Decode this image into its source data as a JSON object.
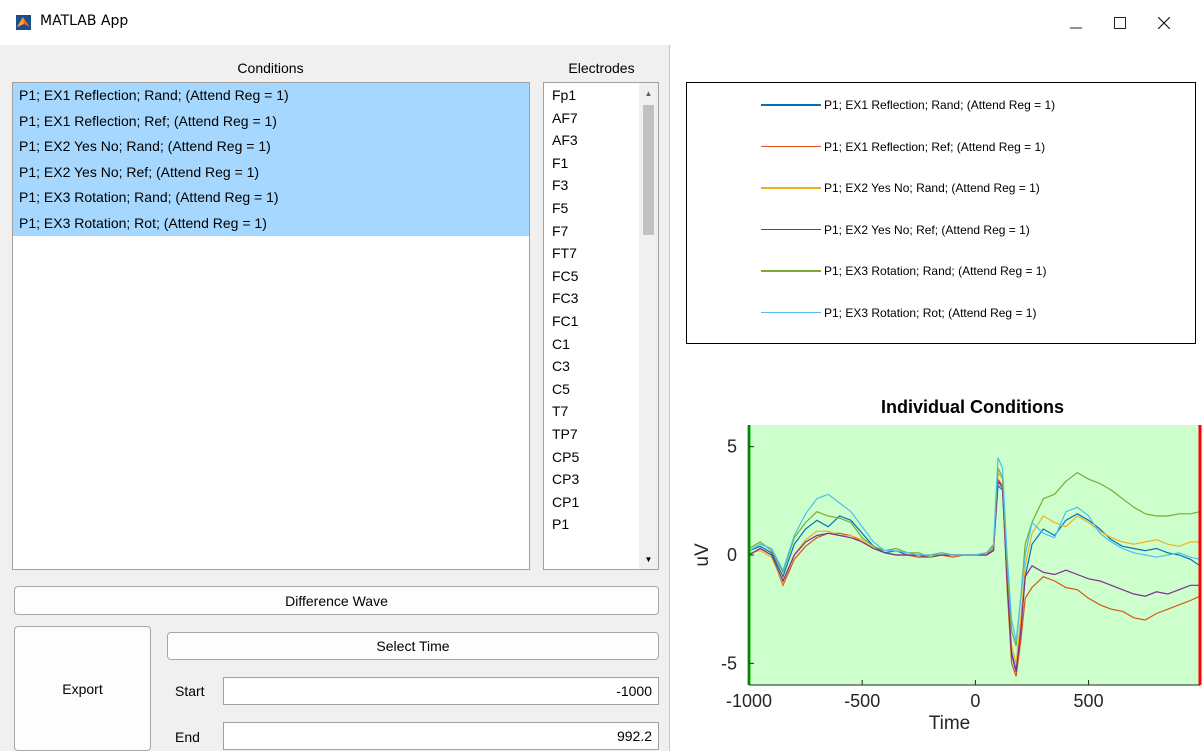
{
  "window": {
    "title": "MATLAB App"
  },
  "conditions": {
    "header": "Conditions",
    "items": [
      "P1; EX1 Reflection; Rand; (Attend Reg = 1)",
      "P1; EX1 Reflection; Ref; (Attend Reg = 1)",
      "P1; EX2 Yes No; Rand; (Attend Reg = 1)",
      "P1; EX2 Yes No; Ref; (Attend Reg = 1)",
      "P1; EX3 Rotation; Rand; (Attend Reg = 1)",
      "P1; EX3 Rotation; Rot; (Attend Reg = 1)"
    ]
  },
  "electrodes": {
    "header": "Electrodes",
    "items": [
      "Fp1",
      "AF7",
      "AF3",
      "F1",
      "F3",
      "F5",
      "F7",
      "FT7",
      "FC5",
      "FC3",
      "FC1",
      "C1",
      "C3",
      "C5",
      "T7",
      "TP7",
      "CP5",
      "CP3",
      "CP1",
      "P1"
    ]
  },
  "buttons": {
    "difference_wave": "Difference Wave",
    "select_time": "Select Time",
    "export": "Export"
  },
  "time_range": {
    "start_label": "Start",
    "start_value": "-1000",
    "end_label": "End",
    "end_value": "992.2"
  },
  "colors": {
    "selection": "#a6d8ff",
    "plot_background": "#ccffcc",
    "start_marker": "#00cc00",
    "end_marker": "#ff0000"
  },
  "chart_data": {
    "type": "line",
    "title": "Individual Conditions",
    "xlabel": "Time",
    "ylabel": "uV",
    "xlim": [
      -1000,
      992.2
    ],
    "ylim": [
      -6,
      6
    ],
    "xticks": [
      -1000,
      -500,
      0,
      500
    ],
    "yticks": [
      -5,
      0,
      5
    ],
    "background": "#ccffcc",
    "vlines": [
      {
        "x": -1000,
        "color": "#00cc00"
      },
      {
        "x": 992.2,
        "color": "#ff0000"
      }
    ],
    "legend_position": "top (separate panel)",
    "x": [
      -1000,
      -950,
      -900,
      -850,
      -800,
      -750,
      -700,
      -650,
      -600,
      -550,
      -500,
      -450,
      -400,
      -350,
      -300,
      -250,
      -200,
      -150,
      -100,
      -50,
      0,
      50,
      80,
      100,
      120,
      140,
      160,
      180,
      200,
      220,
      250,
      300,
      350,
      400,
      450,
      500,
      550,
      600,
      650,
      700,
      750,
      800,
      850,
      900,
      950,
      992
    ],
    "series": [
      {
        "name": "P1; EX1 Reflection; Rand; (Attend Reg = 1)",
        "color": "#0072bd",
        "values": [
          0.2,
          0.4,
          0.1,
          -1.0,
          0.5,
          1.2,
          1.6,
          1.3,
          1.8,
          1.6,
          1.0,
          0.4,
          0.1,
          0.2,
          0.0,
          -0.1,
          0.0,
          0.1,
          0.0,
          0.0,
          0.0,
          0.0,
          0.3,
          3.2,
          3.0,
          -1.0,
          -4.5,
          -5.3,
          -3.5,
          -1.0,
          0.5,
          1.2,
          0.9,
          1.6,
          1.9,
          1.6,
          1.2,
          0.7,
          0.4,
          0.3,
          0.2,
          0.3,
          0.1,
          0.0,
          -0.2,
          -0.5
        ]
      },
      {
        "name": "P1; EX1 Reflection; Ref; (Attend Reg = 1)",
        "color": "#d95319",
        "values": [
          0.0,
          0.3,
          0.0,
          -1.4,
          -0.2,
          0.4,
          0.8,
          1.0,
          1.0,
          0.9,
          0.6,
          0.3,
          0.1,
          0.0,
          0.0,
          -0.1,
          -0.1,
          0.0,
          -0.1,
          0.0,
          0.0,
          0.1,
          0.2,
          3.5,
          3.2,
          -1.5,
          -5.0,
          -5.6,
          -4.0,
          -2.0,
          -1.5,
          -1.0,
          -1.2,
          -1.5,
          -1.6,
          -2.0,
          -2.3,
          -2.5,
          -2.6,
          -2.9,
          -3.0,
          -2.7,
          -2.5,
          -2.3,
          -2.1,
          -1.9
        ]
      },
      {
        "name": "P1; EX2 Yes No; Rand; (Attend Reg = 1)",
        "color": "#edb120",
        "values": [
          0.1,
          0.2,
          -0.1,
          -1.3,
          0.0,
          0.7,
          1.1,
          1.1,
          0.9,
          0.9,
          0.7,
          0.3,
          0.1,
          0.0,
          0.0,
          0.0,
          0.0,
          0.1,
          0.0,
          0.0,
          0.0,
          0.1,
          0.3,
          3.8,
          3.5,
          -1.0,
          -4.2,
          -5.0,
          -3.0,
          -0.5,
          1.0,
          1.8,
          1.5,
          1.3,
          1.8,
          1.5,
          1.1,
          0.8,
          0.6,
          0.5,
          0.6,
          0.7,
          0.5,
          0.4,
          0.6,
          0.6
        ]
      },
      {
        "name": "P1; EX2 Yes No; Ref; (Attend Reg = 1)",
        "color": "#7e2f8e",
        "values": [
          0.0,
          0.3,
          0.0,
          -1.2,
          0.0,
          0.6,
          0.9,
          1.0,
          0.9,
          0.8,
          0.6,
          0.3,
          0.1,
          0.0,
          0.0,
          0.0,
          -0.1,
          0.0,
          0.0,
          0.0,
          0.0,
          0.0,
          0.2,
          3.4,
          3.1,
          -1.2,
          -4.6,
          -5.4,
          -3.5,
          -1.0,
          -0.5,
          -0.8,
          -0.9,
          -0.7,
          -0.9,
          -1.1,
          -1.2,
          -1.4,
          -1.6,
          -1.8,
          -1.9,
          -1.7,
          -1.8,
          -1.6,
          -1.4,
          -1.4
        ]
      },
      {
        "name": "P1; EX3 Rotation; Rand; (Attend Reg = 1)",
        "color": "#77ac30",
        "values": [
          0.3,
          0.6,
          0.2,
          -0.8,
          0.8,
          1.5,
          2.0,
          1.8,
          1.7,
          1.5,
          0.8,
          0.4,
          0.2,
          0.3,
          0.1,
          0.1,
          -0.1,
          0.1,
          0.0,
          0.0,
          0.0,
          0.1,
          0.4,
          4.0,
          3.6,
          -0.5,
          -3.5,
          -4.2,
          -2.0,
          0.5,
          1.5,
          2.6,
          2.8,
          3.4,
          3.8,
          3.5,
          3.3,
          3.0,
          2.6,
          2.2,
          1.9,
          1.8,
          1.8,
          1.9,
          1.9,
          2.0
        ]
      },
      {
        "name": "P1; EX3 Rotation; Rot; (Attend Reg = 1)",
        "color": "#4dbeee",
        "values": [
          0.2,
          0.5,
          0.3,
          -0.7,
          0.9,
          1.9,
          2.6,
          2.8,
          2.4,
          2.0,
          1.3,
          0.6,
          0.2,
          0.2,
          0.1,
          0.0,
          0.0,
          0.1,
          0.0,
          0.0,
          0.0,
          0.1,
          0.5,
          4.5,
          4.0,
          0.0,
          -3.0,
          -4.0,
          -2.0,
          0.0,
          1.5,
          1.0,
          0.8,
          2.0,
          2.2,
          1.8,
          1.0,
          0.6,
          0.3,
          0.1,
          0.0,
          -0.1,
          0.0,
          0.1,
          -0.1,
          -0.2
        ]
      }
    ]
  }
}
